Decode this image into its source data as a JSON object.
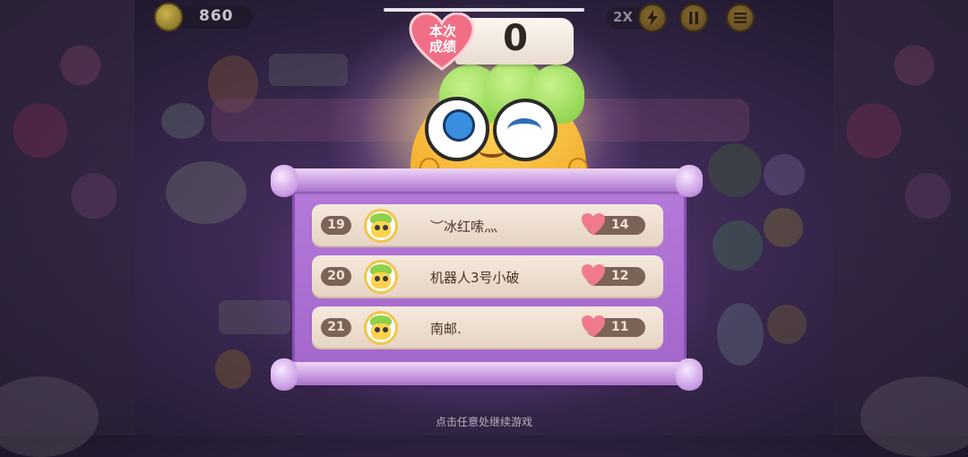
{
  "top_bar": {
    "coin_amount": "860",
    "speed_label": "2X",
    "lightning_icon": "lightning-icon",
    "pause_icon": "pause-icon",
    "menu_icon": "menu-icon"
  },
  "result": {
    "badge_line1": "本次",
    "badge_line2": "成绩",
    "score": "0"
  },
  "leaderboard": [
    {
      "rank": "19",
      "name": "︶冰红嗦灬",
      "hearts": "14"
    },
    {
      "rank": "20",
      "name": "机器人3号小破",
      "hearts": "12"
    },
    {
      "rank": "21",
      "name": "南邮.",
      "hearts": "11"
    }
  ],
  "footer_hint": "点击任意处继续游戏",
  "colors": {
    "scroll": "#b57ad9",
    "row_bg": "#f5e9dd",
    "pill": "#7c6358",
    "heart": "#f07a8c",
    "badge_heart": "#f06f86"
  }
}
